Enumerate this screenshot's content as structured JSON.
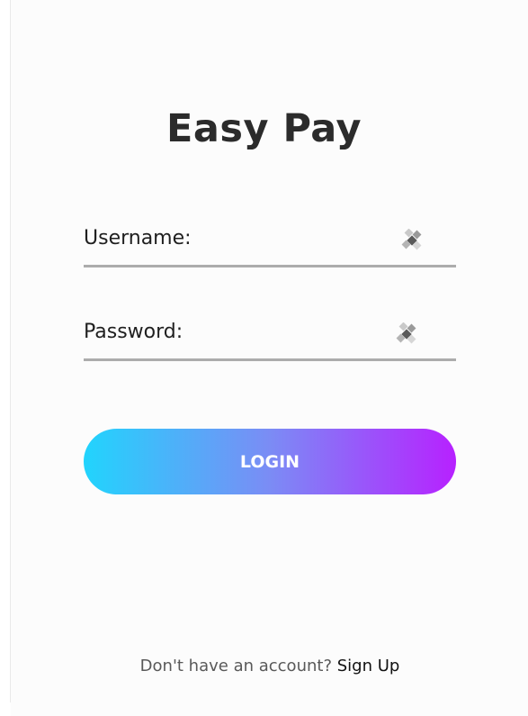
{
  "app": {
    "title": "Easy Pay"
  },
  "form": {
    "username": {
      "label": "Username:",
      "value": "",
      "icon": "autofill-key-icon"
    },
    "password": {
      "label": "Password:",
      "value": "",
      "icon": "autofill-key-icon"
    },
    "login_label": "LOGIN"
  },
  "footer": {
    "prompt": "Don't have an account?",
    "signup_label": "Sign Up"
  },
  "colors": {
    "gradient_start": "#21d4fd",
    "gradient_end": "#b721ff",
    "underline": "#acacac",
    "title": "#2b2b2b"
  }
}
